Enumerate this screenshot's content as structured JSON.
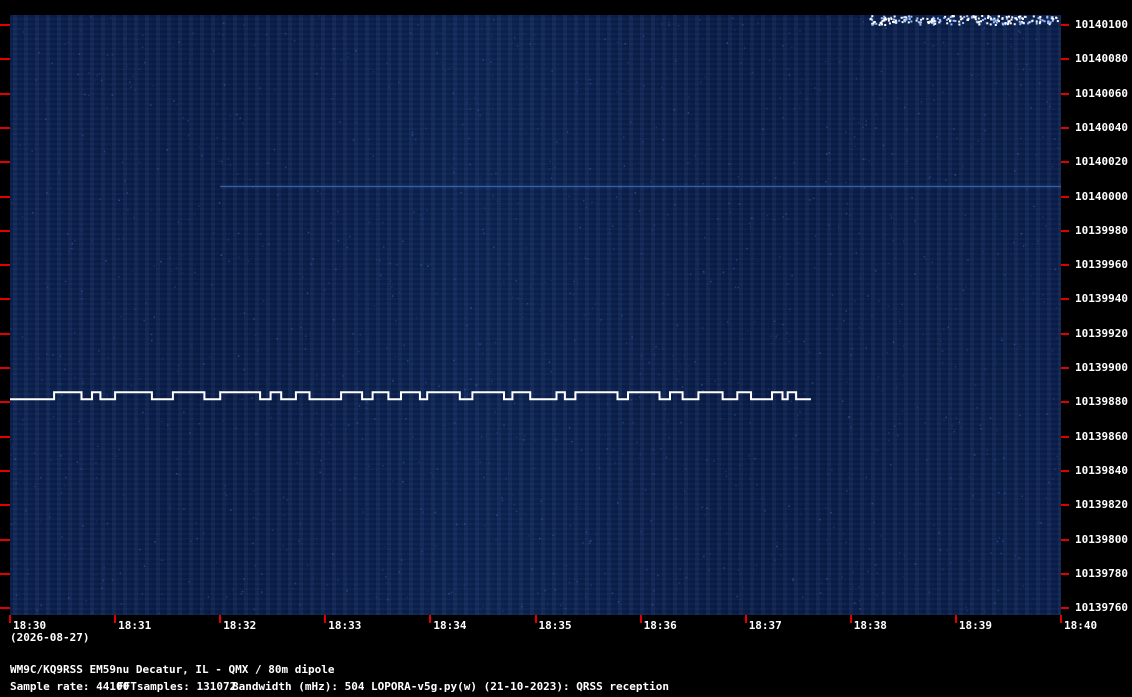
{
  "chart_data": {
    "type": "heatmap",
    "x_labels": [
      "18:30",
      "18:31",
      "18:32",
      "18:33",
      "18:34",
      "18:35",
      "18:36",
      "18:37",
      "18:38",
      "18:39",
      "18:40"
    ],
    "y_labels": [
      "10140100",
      "10140080",
      "10140060",
      "10140040",
      "10140020",
      "10140000",
      "10139980",
      "10139960",
      "10139940",
      "10139920",
      "10139900",
      "10139880",
      "10139860",
      "10139840",
      "10139820",
      "10139800",
      "10139780",
      "10139760"
    ],
    "y_range_mhz": [
      10139760,
      10140100
    ],
    "x_range": [
      "18:30",
      "18:40"
    ],
    "colors": {
      "background": "#0a1f4d",
      "signal": "#ffffff",
      "tick": "#e00000"
    },
    "signals": [
      {
        "name": "",
        "freq_low": 10139876,
        "freq_high": 10139880,
        "start": "18:30",
        "end": "18:37.6",
        "pattern": [
          [
            0,
            0
          ],
          [
            0.42,
            0
          ],
          [
            0.42,
            1
          ],
          [
            0.68,
            1
          ],
          [
            0.68,
            0
          ],
          [
            0.78,
            0
          ],
          [
            0.78,
            1
          ],
          [
            0.86,
            1
          ],
          [
            0.86,
            0
          ],
          [
            1.0,
            0
          ],
          [
            1.0,
            1
          ],
          [
            1.35,
            1
          ],
          [
            1.35,
            0
          ],
          [
            1.55,
            0
          ],
          [
            1.55,
            1
          ],
          [
            1.85,
            1
          ],
          [
            1.85,
            0
          ],
          [
            2.0,
            0
          ],
          [
            2.0,
            1
          ],
          [
            2.38,
            1
          ],
          [
            2.38,
            0
          ],
          [
            2.48,
            0
          ],
          [
            2.48,
            1
          ],
          [
            2.58,
            1
          ],
          [
            2.58,
            0
          ],
          [
            2.72,
            0
          ],
          [
            2.72,
            1
          ],
          [
            2.85,
            1
          ],
          [
            2.85,
            0
          ],
          [
            3.15,
            0
          ],
          [
            3.15,
            1
          ],
          [
            3.35,
            1
          ],
          [
            3.35,
            0
          ],
          [
            3.45,
            0
          ],
          [
            3.45,
            1
          ],
          [
            3.6,
            1
          ],
          [
            3.6,
            0
          ],
          [
            3.72,
            0
          ],
          [
            3.72,
            1
          ],
          [
            3.9,
            1
          ],
          [
            3.9,
            0
          ],
          [
            3.97,
            0
          ],
          [
            3.97,
            1
          ],
          [
            4.28,
            1
          ],
          [
            4.28,
            0
          ],
          [
            4.4,
            0
          ],
          [
            4.4,
            1
          ],
          [
            4.7,
            1
          ],
          [
            4.7,
            0
          ],
          [
            4.78,
            0
          ],
          [
            4.78,
            1
          ],
          [
            4.95,
            1
          ],
          [
            4.95,
            0
          ],
          [
            5.2,
            0
          ],
          [
            5.2,
            1
          ],
          [
            5.28,
            1
          ],
          [
            5.28,
            0
          ],
          [
            5.38,
            0
          ],
          [
            5.38,
            1
          ],
          [
            5.78,
            1
          ],
          [
            5.78,
            0
          ],
          [
            5.88,
            0
          ],
          [
            5.88,
            1
          ],
          [
            6.18,
            1
          ],
          [
            6.18,
            0
          ],
          [
            6.28,
            0
          ],
          [
            6.28,
            1
          ],
          [
            6.4,
            1
          ],
          [
            6.4,
            0
          ],
          [
            6.55,
            0
          ],
          [
            6.55,
            1
          ],
          [
            6.78,
            1
          ],
          [
            6.78,
            0
          ],
          [
            6.92,
            0
          ],
          [
            6.92,
            1
          ],
          [
            7.05,
            1
          ],
          [
            7.05,
            0
          ],
          [
            7.25,
            0
          ],
          [
            7.25,
            1
          ],
          [
            7.35,
            1
          ],
          [
            7.35,
            0
          ],
          [
            7.4,
            0
          ],
          [
            7.4,
            1
          ],
          [
            7.48,
            1
          ],
          [
            7.48,
            0
          ],
          [
            7.62,
            0
          ]
        ]
      },
      {
        "name": "",
        "freq": 10140000,
        "start": "18:32",
        "end": "18:40"
      }
    ]
  },
  "xlabel_date": "(2026-08-27)",
  "footer": {
    "line1": "WM9C/KQ9RSS EM59nu Decatur, IL - QMX / 80m dipole",
    "sample_rate": "Sample rate: 44100",
    "fft": "FFTsamples: 131072",
    "bandwidth": "Bandwidth (mHz): 504",
    "software": "LOPORA-v5g.py(w) (21-10-2023): QRSS reception"
  }
}
